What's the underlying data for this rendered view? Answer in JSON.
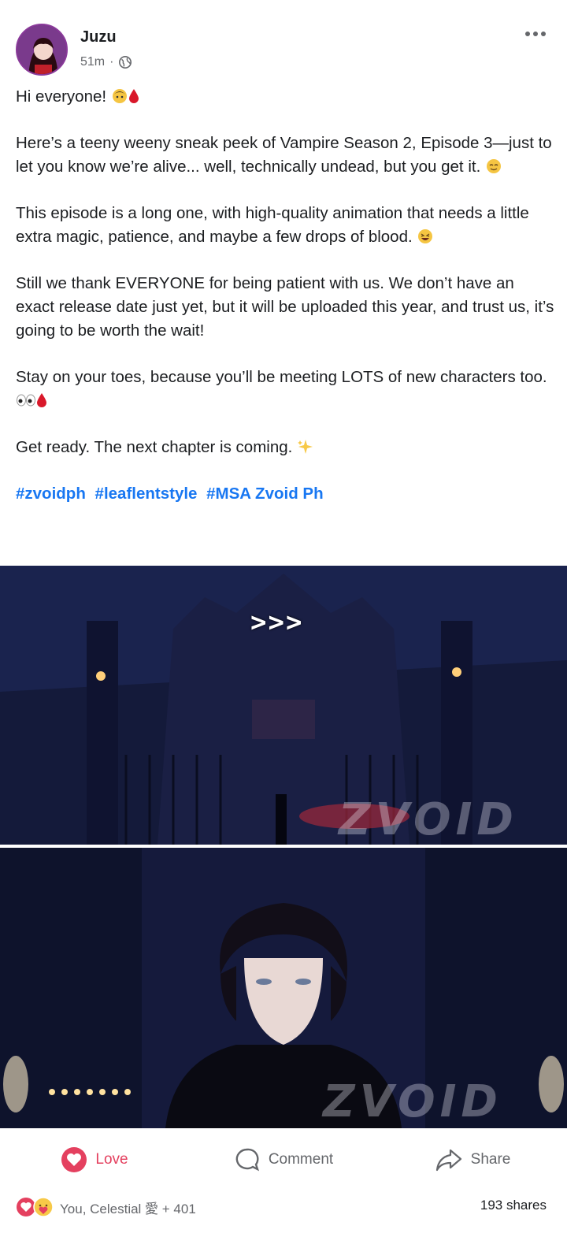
{
  "post": {
    "author": "Juzu",
    "time": "51m",
    "separator": "·",
    "privacy_icon": "globe-icon",
    "paragraphs": [
      "Hi everyone! ",
      "Here’s a teeny weeny sneak peek of Vampire Season 2, Episode 3—just to let you know we’re alive... well, technically undead, but you get it. ",
      "This episode is a long one, with high-quality animation that needs a little extra magic, patience, and maybe a few drops of blood. ",
      "Still we thank EVERYONE for being patient with us. We don’t have an exact release date just yet, but it will be uploaded this year, and trust us, it’s going to be worth the wait!",
      "Stay on your toes, because you’ll be meeting LOTS of new characters too. ",
      "Get ready. The next chapter is coming. "
    ],
    "hashtags": [
      "#zvoidph",
      "#leaflentstyle",
      "#MSA Zvoid Ph"
    ]
  },
  "media": {
    "image1_overlay": ">>>",
    "watermark": "ZVOID"
  },
  "actions": {
    "love": "Love",
    "comment": "Comment",
    "share": "Share"
  },
  "reactions": {
    "summary": "You, Celestial 愛 + 401",
    "shares": "193 shares"
  },
  "colors": {
    "link": "#1877f2",
    "love": "#e4405f",
    "muted": "#65676b"
  }
}
